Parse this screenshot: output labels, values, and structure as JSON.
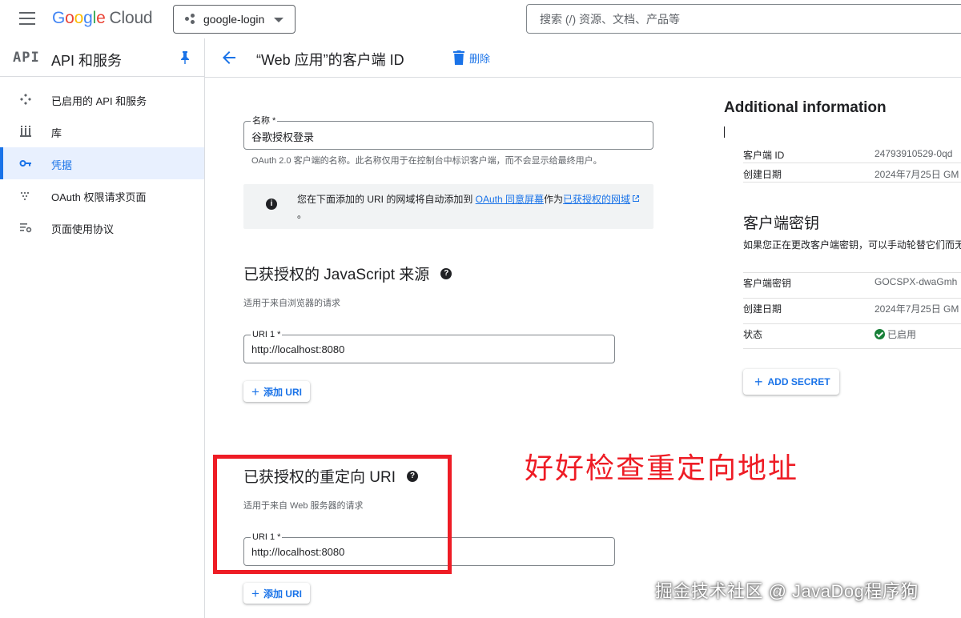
{
  "header": {
    "logo_google": "Google",
    "logo_cloud": "Cloud",
    "project_name": "google-login",
    "search_placeholder": "搜索 (/) 资源、文档、产品等"
  },
  "sidebar": {
    "api_mark": "API",
    "title": "API 和服务",
    "items": [
      {
        "label": "已启用的 API 和服务",
        "icon": "diamond-grid-icon"
      },
      {
        "label": "库",
        "icon": "library-icon"
      },
      {
        "label": "凭据",
        "icon": "key-icon",
        "active": true
      },
      {
        "label": "OAuth 权限请求页面",
        "icon": "dots-consent-icon"
      },
      {
        "label": "页面使用协议",
        "icon": "settings-list-icon"
      }
    ]
  },
  "content": {
    "page_title": "“Web 应用”的客户端 ID",
    "delete_label": "删除",
    "name_field": {
      "label": "名称 *",
      "value": "谷歌授权登录",
      "hint": "OAuth 2.0 客户端的名称。此名称仅用于在控制台中标识客户端，而不会显示给最终用户。"
    },
    "info_box": {
      "text_before": "您在下面添加的 URI 的网域将自动添加到 ",
      "link1": "OAuth 同意屏幕",
      "text_mid": "作为",
      "link2": "已获授权的网域",
      "text_after": "。"
    },
    "js_origins": {
      "title": "已获授权的 JavaScript 来源",
      "subtitle": "适用于来自浏览器的请求",
      "uri_label": "URI 1 *",
      "uri_value": "http://localhost:8080",
      "add_label": "添加 URI"
    },
    "redirect_uris": {
      "title": "已获授权的重定向 URI",
      "subtitle": "适用于来自 Web 服务器的请求",
      "uri_label": "URI 1 *",
      "uri_value": "http://localhost:8080",
      "add_label": "添加 URI"
    }
  },
  "additional_info": {
    "title": "Additional information",
    "rows": [
      {
        "key": "客户端 ID",
        "value": "24793910529-0qd"
      },
      {
        "key": "创建日期",
        "value": "2024年7月25日 GM"
      }
    ],
    "secret_title": "客户端密钥",
    "secret_desc": "如果您正在更改客户端密钥，可以手动轮替它们而无",
    "secret_rows": [
      {
        "key": "客户端密钥",
        "value": "GOCSPX-dwaGmh"
      },
      {
        "key": "创建日期",
        "value": "2024年7月25日 GM"
      },
      {
        "key": "状态",
        "value": "已启用"
      }
    ],
    "add_secret_label": "ADD SECRET"
  },
  "annotation": {
    "text": "好好检查重定向地址",
    "color": "#ee1c25"
  },
  "watermark": "掘金技术社区 @ JavaDog程序狗",
  "colors": {
    "accent": "#1a73e8",
    "status_ok": "#188038"
  }
}
